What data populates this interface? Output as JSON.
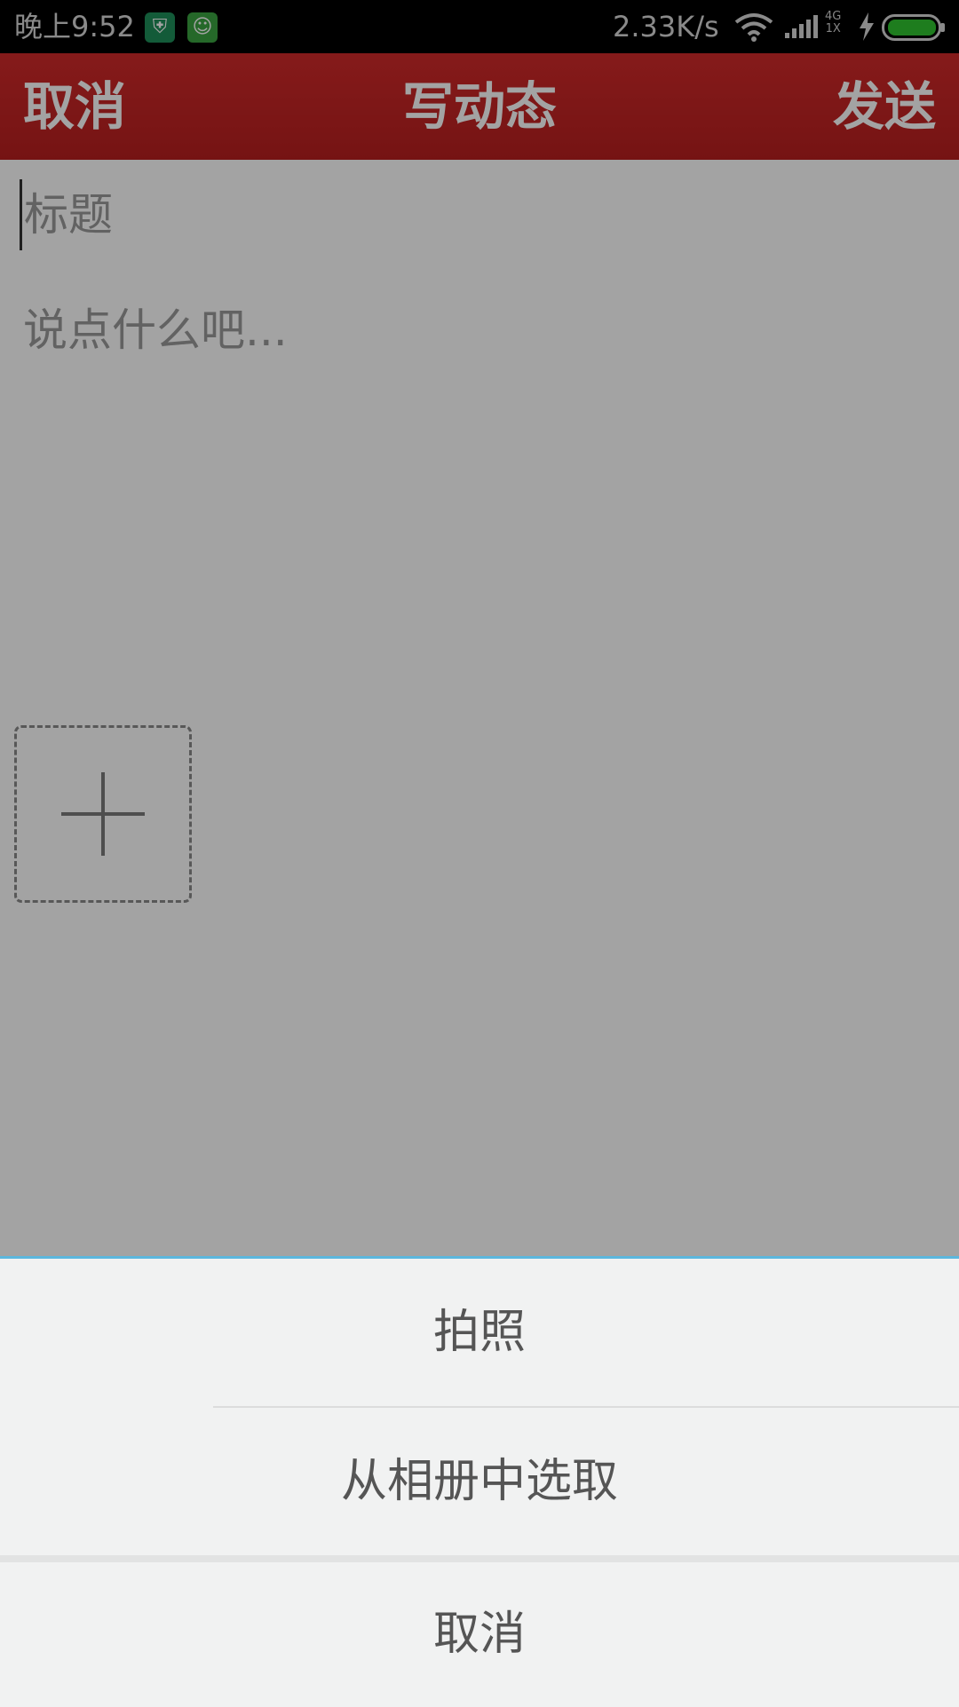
{
  "status_bar": {
    "time": "晚上9:52",
    "net_speed": "2.33K/s",
    "network_type_top": "4G",
    "network_type_bottom": "1X",
    "icons": [
      "shield-app-icon",
      "cat-app-icon",
      "wifi-icon",
      "signal-icon",
      "charging-icon",
      "battery-icon"
    ]
  },
  "header": {
    "cancel_label": "取消",
    "title": "写动态",
    "send_label": "发送",
    "color": "#c62828"
  },
  "form": {
    "title_placeholder": "标题",
    "body_placeholder": "说点什么吧...",
    "add_photo_icon": "plus-icon"
  },
  "action_sheet": {
    "take_photo": "拍照",
    "choose_album": "从相册中选取",
    "cancel": "取消",
    "accent": "#5bb7dd"
  }
}
